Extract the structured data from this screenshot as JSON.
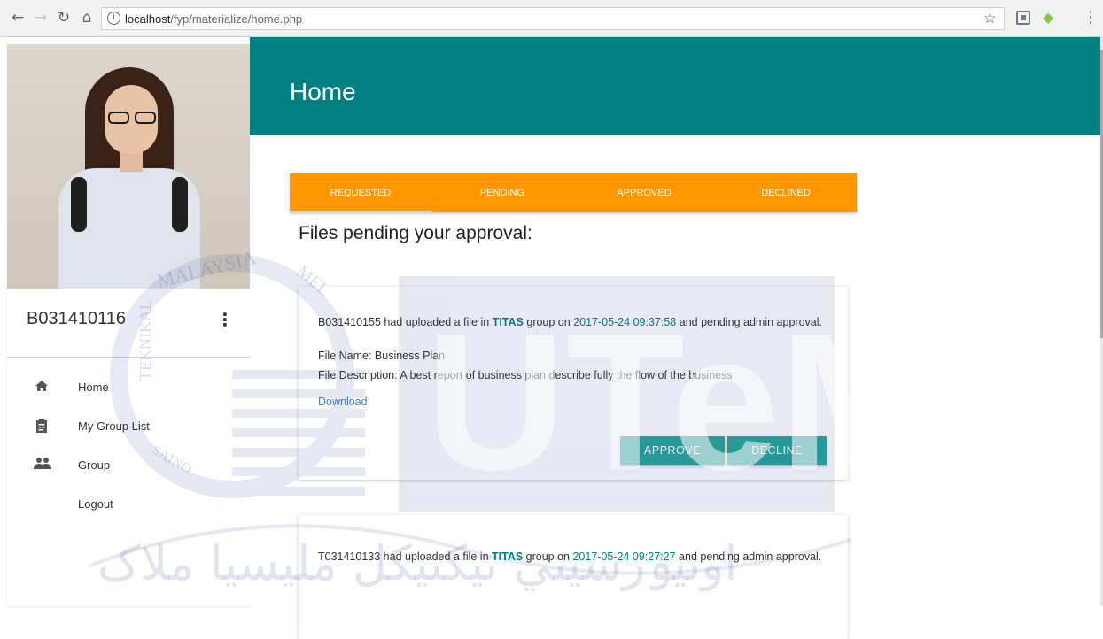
{
  "browser": {
    "url_host": "localhost",
    "url_path": "/fyp/materialize/home.php",
    "back_icon": "arrow-left-icon",
    "forward_icon": "arrow-right-icon",
    "reload_icon": "reload-icon",
    "home_icon": "home-icon"
  },
  "sidebar": {
    "user_id": "B031410116",
    "items": [
      {
        "label": "Home",
        "icon": "home-icon"
      },
      {
        "label": "My Group List",
        "icon": "clipboard-icon"
      },
      {
        "label": "Group",
        "icon": "people-icon"
      },
      {
        "label": "Logout",
        "icon": ""
      }
    ]
  },
  "header": {
    "title": "Home"
  },
  "tabs": [
    {
      "label": "REQUESTED",
      "active": true
    },
    {
      "label": "PENDING",
      "active": false
    },
    {
      "label": "APPROVED",
      "active": false
    },
    {
      "label": "DECLINED",
      "active": false
    }
  ],
  "main": {
    "section_title": "Files pending your approval:",
    "requests": [
      {
        "user": "B031410155",
        "text_a": " had uploaded a file in ",
        "group": "TITAS",
        "text_b": " group on ",
        "date": "2017-05-24 09:37:58",
        "text_c": " and pending admin approval.",
        "file_name": "File Name: Business Plan",
        "file_description": "File Description: A best report of business plan describe fully the flow of the business",
        "download_label": "Download",
        "approve_label": "APPROVE",
        "decline_label": "DECLINE"
      },
      {
        "user": "T031410133",
        "text_a": " had uploaded a file in ",
        "group": "TITAS",
        "text_b": " group on ",
        "date": "2017-05-24 09:27:27",
        "text_c": " and pending admin approval."
      }
    ]
  },
  "watermark": {
    "logo_text": "UTeM",
    "seal_text": "MALAYSIA",
    "seal_text_2": "MEL",
    "seal_text_3": "TEKNIKAL",
    "seal_text_4": "SAINO",
    "arabic_text": "اونيۏرسيتي تيکنيکل مليسيا ملاک"
  },
  "colors": {
    "header": "#008080",
    "tabs": "#ff9800",
    "button": "#26a69a",
    "watermark": "#2b3c8f"
  }
}
